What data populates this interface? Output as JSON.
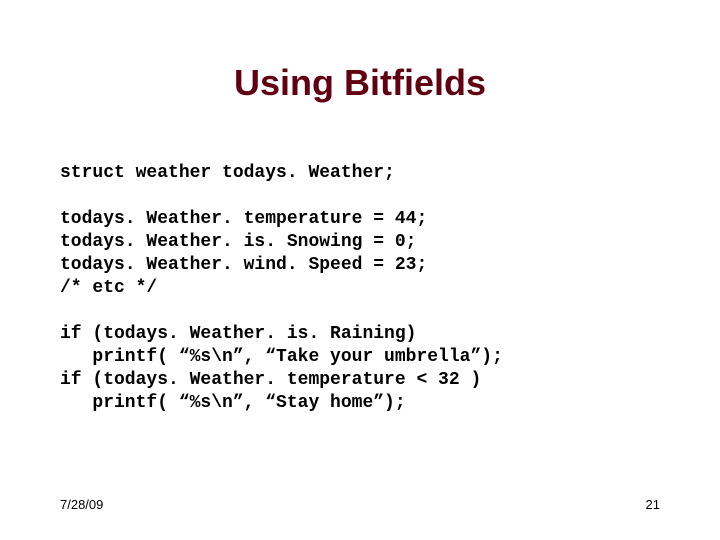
{
  "slide": {
    "title": "Using Bitfields",
    "code": "struct weather todays. Weather;\n\ntodays. Weather. temperature = 44;\ntodays. Weather. is. Snowing = 0;\ntodays. Weather. wind. Speed = 23;\n/* etc */\n\nif (todays. Weather. is. Raining)\n   printf( “%s\\n”, “Take your umbrella”);\nif (todays. Weather. temperature < 32 )\n   printf( “%s\\n”, “Stay home”);",
    "footer_date": "7/28/09",
    "page_number": "21"
  }
}
